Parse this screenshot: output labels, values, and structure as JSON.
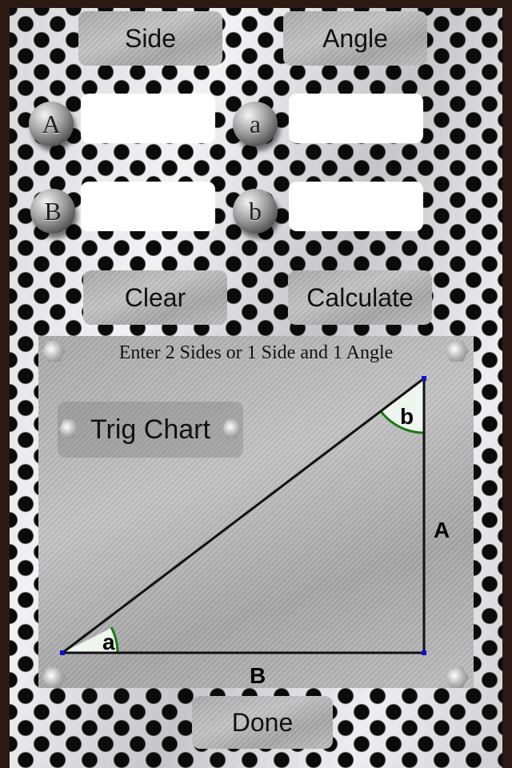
{
  "buttons": {
    "side": "Side",
    "angle": "Angle",
    "clear": "Clear",
    "calculate": "Calculate",
    "trig_chart": "Trig Chart",
    "done": "Done"
  },
  "fields": {
    "A": {
      "label": "A",
      "value": ""
    },
    "a": {
      "label": "a",
      "value": ""
    },
    "B": {
      "label": "B",
      "value": ""
    },
    "b": {
      "label": "b",
      "value": ""
    }
  },
  "panel": {
    "instruction": "Enter 2 Sides or 1 Side and 1 Angle"
  },
  "diagram": {
    "angle_a": "a",
    "angle_b": "b",
    "side_A": "A",
    "side_B": "B",
    "line_color": "#111111",
    "arc_color": "#1a7a1a",
    "vertex_color": "#1010d0"
  }
}
